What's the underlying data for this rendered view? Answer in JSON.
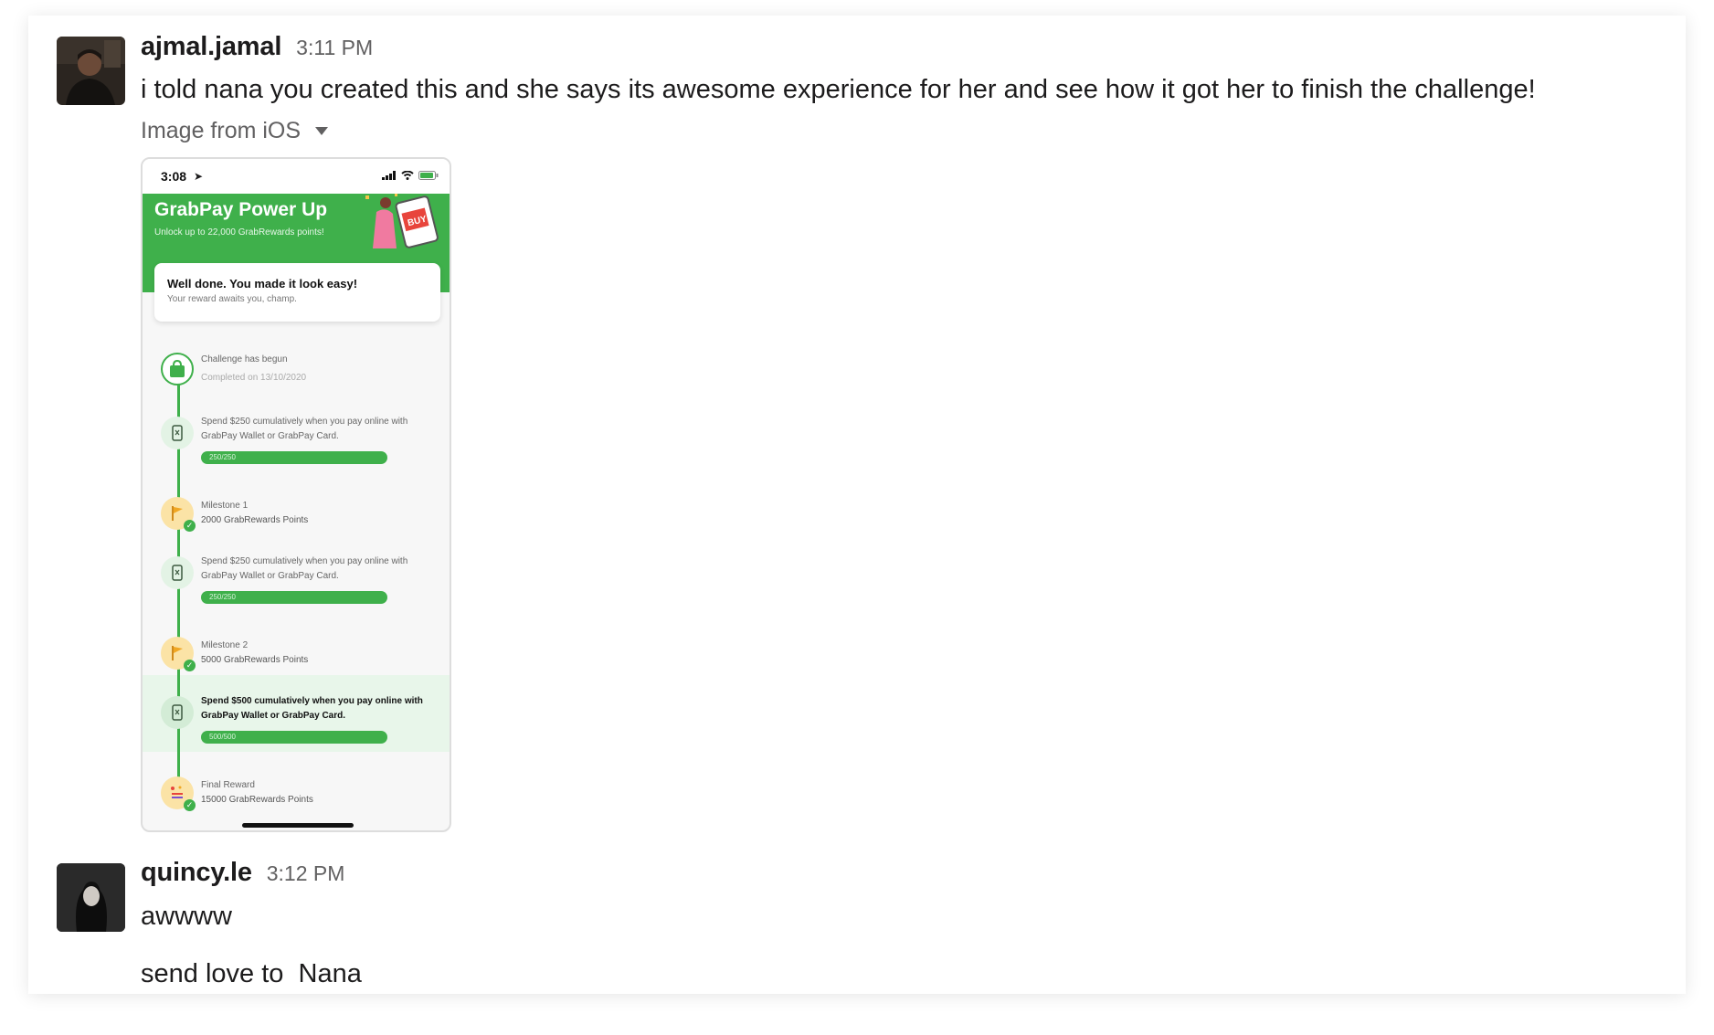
{
  "messages": [
    {
      "user": "ajmal.jamal",
      "time": "3:11 PM",
      "text": "i told nana you created this and she says its awesome experience for her and see how it got her to finish the challenge!",
      "attachment_label": "Image from iOS",
      "attachment_icon": "chevron-down-icon"
    },
    {
      "user": "quincy.le",
      "time": "3:12 PM",
      "lines": [
        "awwww",
        "send love to  Nana"
      ]
    }
  ],
  "phone": {
    "clock": "3:08",
    "banner_title": "GrabPay Power Up",
    "banner_subtitle": "Unlock up to 22,000 GrabRewards points!",
    "done_title": "Well done. You made it look easy!",
    "done_subtitle": "Your reward awaits you, champ.",
    "steps": [
      {
        "l1": "Challenge has begun",
        "l2": "Completed on 13/10/2020",
        "icon": "bag-icon"
      },
      {
        "l1": "Spend $250 cumulatively when you pay online with",
        "l2": "GrabPay Wallet or GrabPay Card.",
        "progress": "250/250",
        "icon": "phone-icon"
      },
      {
        "l1": "Milestone 1",
        "l2": "2000 GrabRewards Points",
        "icon": "flag-icon"
      },
      {
        "l1": "Spend $250 cumulatively when you pay online with",
        "l2": "GrabPay Wallet or GrabPay Card.",
        "progress": "250/250",
        "icon": "phone-icon"
      },
      {
        "l1": "Milestone 2",
        "l2": "5000 GrabRewards Points",
        "icon": "flag-icon"
      },
      {
        "l1": "Spend $500 cumulatively when you pay online with",
        "l2": "GrabPay Wallet or GrabPay Card.",
        "progress": "500/500",
        "icon": "phone-icon"
      },
      {
        "l1": "Final Reward",
        "l2": "15000 GrabRewards Points",
        "icon": "gift-icon"
      }
    ]
  },
  "colors": {
    "brand_green": "#3fb04b",
    "milestone_yellow": "#f6c548",
    "text_primary": "#1d1c1d",
    "text_secondary": "#616061"
  }
}
